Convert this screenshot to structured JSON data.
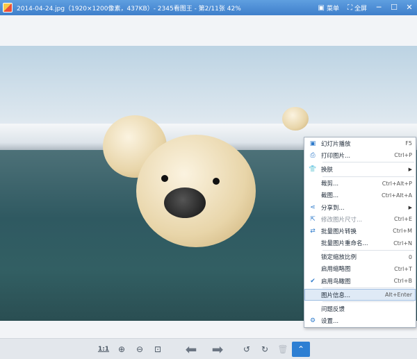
{
  "window": {
    "title": "2014-04-24.jpg（1920×1200像素，437KB）- 2345看图王 - 第2/11张 42%",
    "menu_label": "菜单",
    "fullscreen_label": "全屏",
    "minimize": "─",
    "maximize": "☐",
    "close": "✕"
  },
  "toolbar": {
    "ratio_label": "1:1"
  },
  "context_menu": {
    "items": [
      {
        "label": "幻灯片播放",
        "shortcut": "F5",
        "icon": "slideshow-icon"
      },
      {
        "label": "打印图片...",
        "shortcut": "Ctrl+P",
        "icon": "print-icon"
      },
      {
        "label": "换肤",
        "shortcut": "",
        "icon": "tshirt-icon",
        "submenu": true
      },
      {
        "label": "裁剪...",
        "shortcut": "Ctrl+Alt+P"
      },
      {
        "label": "截图...",
        "shortcut": "Ctrl+Alt+A"
      },
      {
        "label": "分享到...",
        "shortcut": "",
        "icon": "share-icon",
        "submenu": true
      },
      {
        "label": "修改图片尺寸...",
        "shortcut": "Ctrl+E",
        "icon": "resize-icon",
        "disabled": true
      },
      {
        "label": "批量图片转换",
        "shortcut": "Ctrl+M",
        "icon": "convert-icon"
      },
      {
        "label": "批量图片重命名...",
        "shortcut": "Ctrl+N"
      },
      {
        "label": "锁定缩放比例",
        "shortcut": "0"
      },
      {
        "label": "启用缩略图",
        "shortcut": "Ctrl+T"
      },
      {
        "label": "启用鸟瞰图",
        "shortcut": "Ctrl+B",
        "checked": true
      },
      {
        "label": "图片信息...",
        "shortcut": "Alt+Enter",
        "highlighted": true
      },
      {
        "label": "问题反馈",
        "shortcut": ""
      },
      {
        "label": "设置...",
        "shortcut": "",
        "icon": "gear-icon"
      }
    ]
  }
}
